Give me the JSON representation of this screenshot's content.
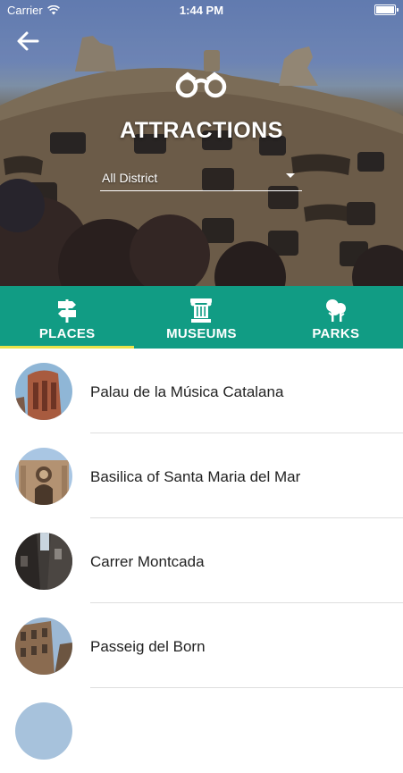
{
  "status_bar": {
    "carrier": "Carrier",
    "time": "1:44 PM"
  },
  "header": {
    "title": "ATTRACTIONS",
    "district_selected": "All District"
  },
  "tabs": [
    {
      "label": "PLACES",
      "icon": "signpost-icon",
      "active": true
    },
    {
      "label": "MUSEUMS",
      "icon": "museum-column-icon",
      "active": false
    },
    {
      "label": "PARKS",
      "icon": "trees-icon",
      "active": false
    }
  ],
  "places": [
    {
      "label": "Palau de la Música Catalana"
    },
    {
      "label": "Basilica of Santa Maria del Mar"
    },
    {
      "label": "Carrer Montcada"
    },
    {
      "label": "Passeig del Born"
    }
  ],
  "colors": {
    "tab_bar": "#119c84",
    "active_indicator": "#e9e34a"
  }
}
